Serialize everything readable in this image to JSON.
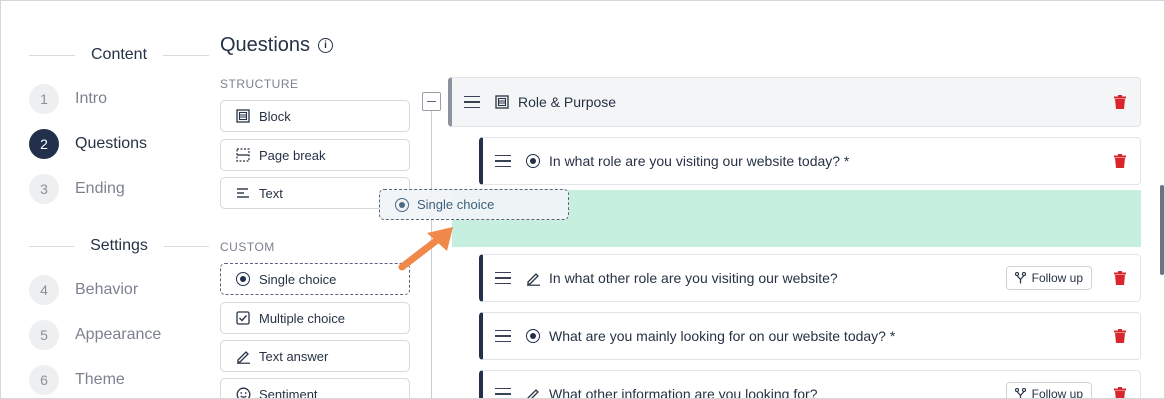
{
  "sidebar": {
    "content_heading": "Content",
    "settings_heading": "Settings",
    "content_steps": [
      {
        "number": "1",
        "label": "Intro"
      },
      {
        "number": "2",
        "label": "Questions",
        "active": true
      },
      {
        "number": "3",
        "label": "Ending"
      }
    ],
    "settings_steps": [
      {
        "number": "4",
        "label": "Behavior"
      },
      {
        "number": "5",
        "label": "Appearance"
      },
      {
        "number": "6",
        "label": "Theme"
      }
    ]
  },
  "page": {
    "title": "Questions",
    "info_icon": "i"
  },
  "palette": {
    "structure_label": "STRUCTURE",
    "structure_items": [
      {
        "label": "Block",
        "icon": "block-icon"
      },
      {
        "label": "Page break",
        "icon": "page-break-icon"
      },
      {
        "label": "Text",
        "icon": "text-icon"
      }
    ],
    "custom_label": "CUSTOM",
    "custom_items": [
      {
        "label": "Single choice",
        "icon": "radio-icon"
      },
      {
        "label": "Multiple choice",
        "icon": "checkbox-icon"
      },
      {
        "label": "Text answer",
        "icon": "pencil-icon"
      },
      {
        "label": "Sentiment",
        "icon": "smiley-icon"
      }
    ]
  },
  "builder": {
    "block_title": "Role & Purpose",
    "dragging_label": "Single choice",
    "questions": [
      {
        "text": "In what role are you visiting our website today? *",
        "type_icon": "radio-icon"
      },
      {
        "text": "In what other role are you visiting our website?",
        "type_icon": "pencil-icon",
        "follow_up": "Follow up"
      },
      {
        "text": "What are you mainly looking for on our website today? *",
        "type_icon": "radio-icon"
      },
      {
        "text": "What other information are you looking for?",
        "type_icon": "pencil-icon",
        "follow_up": "Follow up"
      }
    ]
  },
  "colors": {
    "accent": "#22304c",
    "drop_zone": "#c6efe0",
    "arrow": "#f0884a",
    "delete": "#d9262c"
  }
}
